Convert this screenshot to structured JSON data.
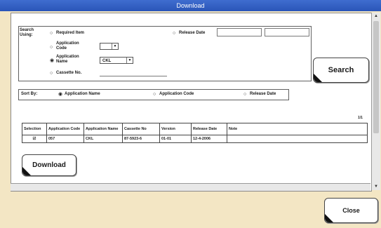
{
  "window": {
    "title": "Download"
  },
  "search": {
    "group_label": "Search Using:",
    "options": {
      "required_item": "Required Item",
      "application_code": "Application Code",
      "application_name": "Application Name",
      "cassette_no": "Cassette No.",
      "release_date": "Release Date"
    },
    "selected": "application_name",
    "application_name_value": "CKL",
    "button_label": "Search"
  },
  "sort": {
    "label": "Sort By:",
    "options": [
      "Application Name",
      "Application Code",
      "Release Date"
    ],
    "selected": "Application Name"
  },
  "results": {
    "count": "1/1",
    "columns": [
      "Selection",
      "Application Code",
      "Application Name",
      "Cassette No",
      "Version",
      "Release Date",
      "Note"
    ],
    "rows": [
      {
        "selection": "☑",
        "application_code": "057",
        "application_name": "CKL",
        "cassette_no": "87-5923-6",
        "version": "01-01",
        "release_date": "12-4-2006",
        "note": ""
      }
    ]
  },
  "actions": {
    "download_label": "Download",
    "close_label": "Close"
  },
  "colors": {
    "titlebar": "#2f5fc4",
    "background": "#f3e6c4",
    "panel": "#ffffff"
  }
}
